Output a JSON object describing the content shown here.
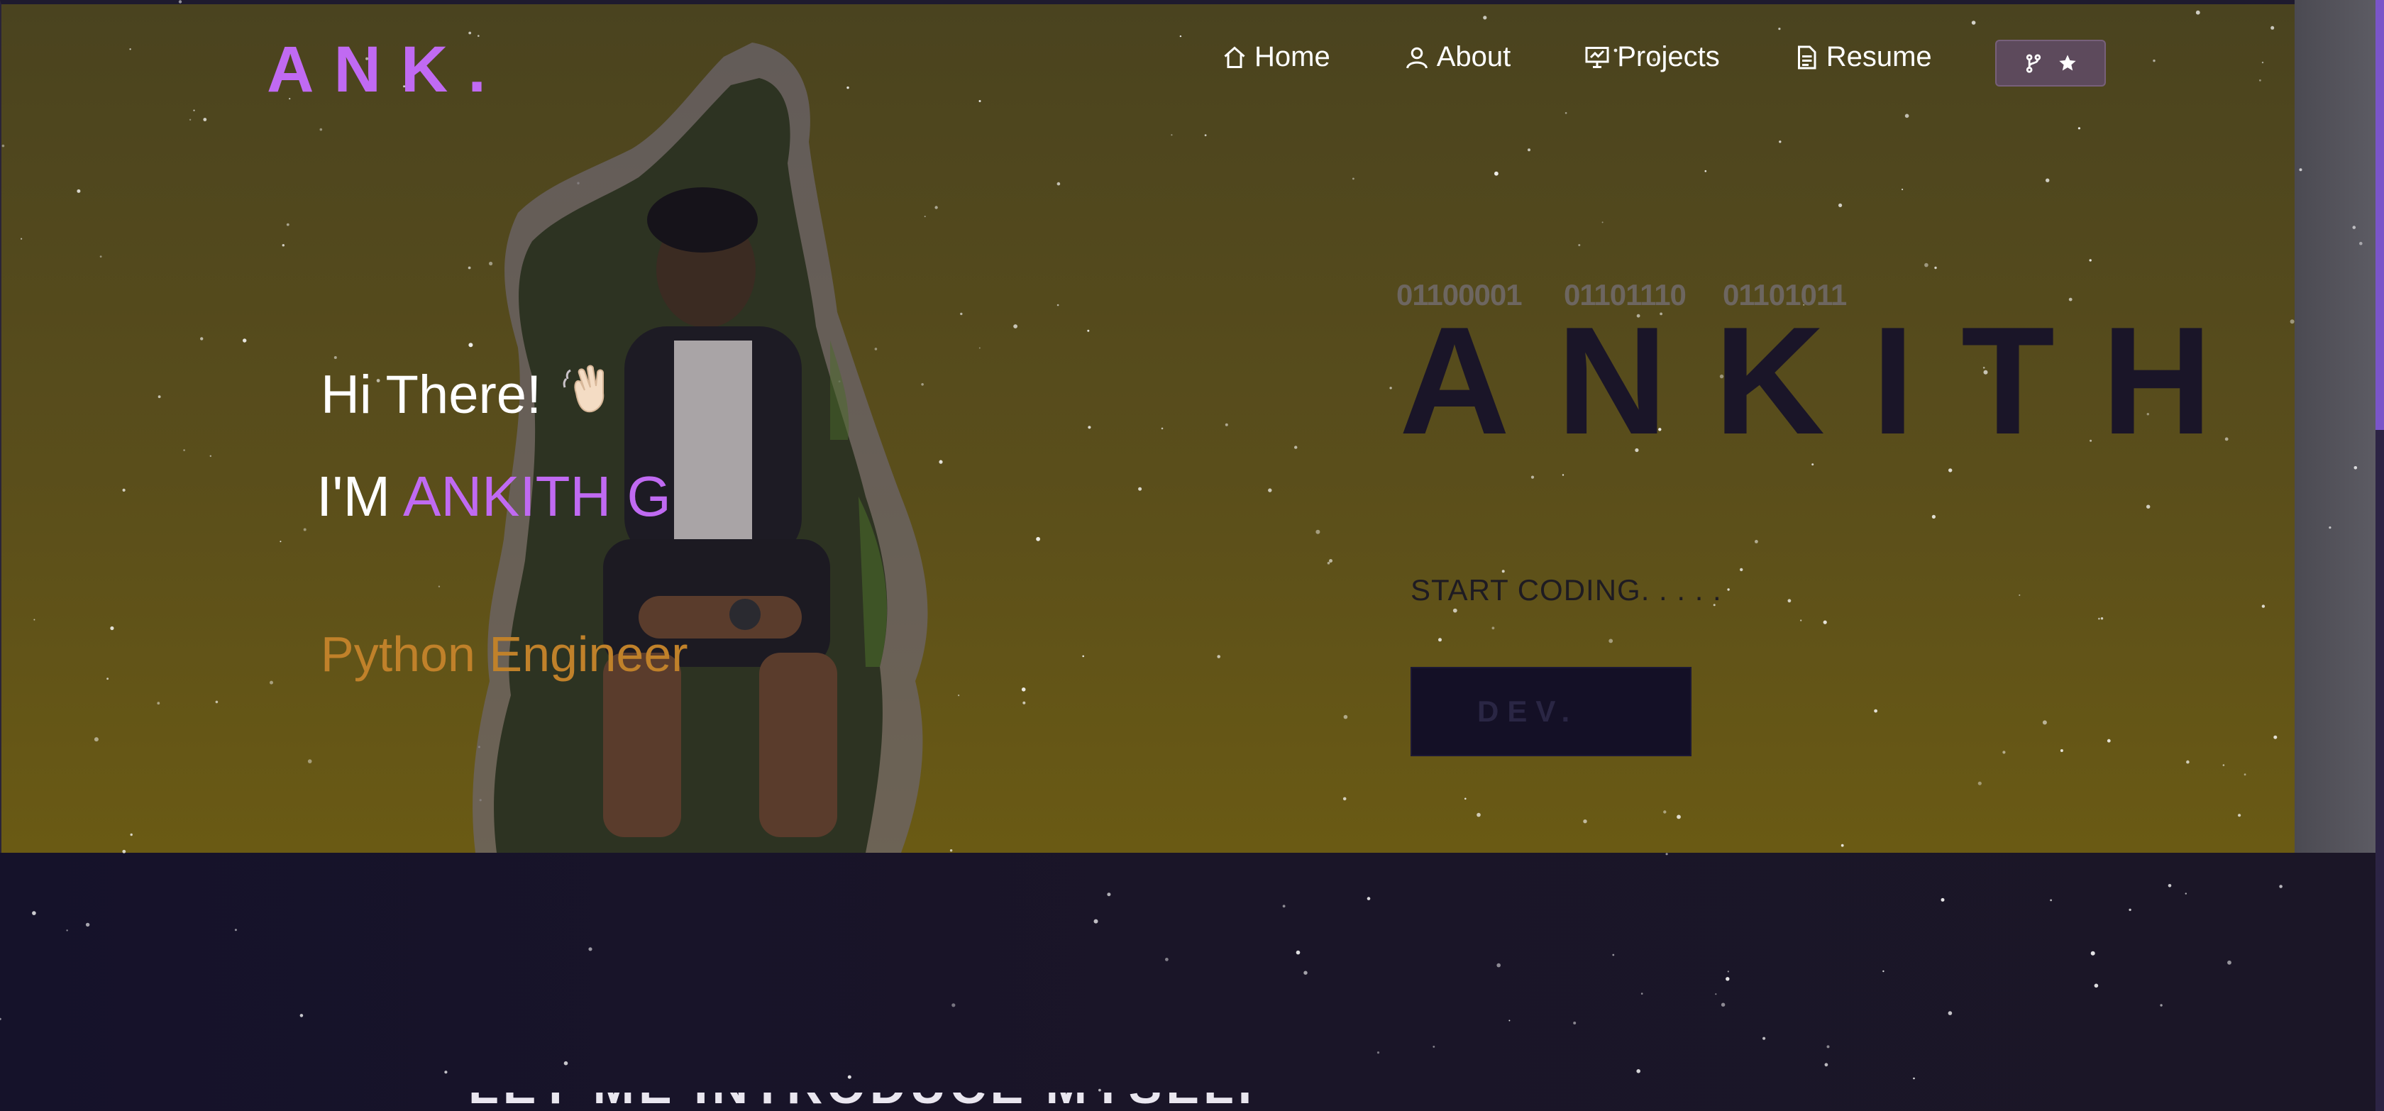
{
  "logo": "ANK.",
  "nav": {
    "items": [
      {
        "label": "Home",
        "icon": "home-icon"
      },
      {
        "label": "About",
        "icon": "user-icon"
      },
      {
        "label": "Projects",
        "icon": "projects-icon"
      },
      {
        "label": "Resume",
        "icon": "document-icon"
      }
    ],
    "fork_icon": "git-fork-icon",
    "star_icon": "star-icon"
  },
  "hero": {
    "greeting": "Hi There!",
    "greeting_emoji": "waving-hand",
    "iam_prefix": "I'M",
    "name": "ANKITH G",
    "role": "Python Engineer"
  },
  "right": {
    "binary": [
      "01100001",
      "01101110",
      "01101011"
    ],
    "big_name": "ANKITH",
    "start_text": "START CODING. . . . .",
    "dev_button": "DEV."
  },
  "bottom": {
    "cut_heading": "LET ME INTRODUCE MYSELF"
  },
  "colors": {
    "accent": "#c06af2",
    "role": "#c0812a",
    "hero_bg": "#55491c",
    "page_bg": "#171326"
  }
}
